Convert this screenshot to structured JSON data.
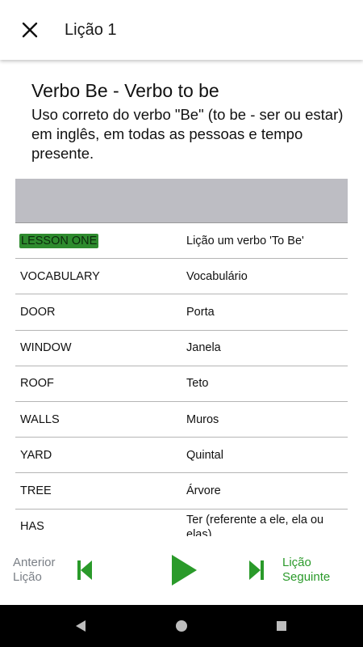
{
  "appbar": {
    "title": "Lição 1"
  },
  "lesson": {
    "title": "Verbo Be - Verbo to be",
    "subtitle": "Uso correto do verbo \"Be\" (to be - ser ou estar) em inglês, em todas as pessoas e tempo presente."
  },
  "vocab_rows": [
    {
      "en": "LESSON ONE",
      "pt": "Lição um verbo 'To Be'"
    },
    {
      "en": "VOCABULARY",
      "pt": "Vocabulário"
    },
    {
      "en": "DOOR",
      "pt": "Porta"
    },
    {
      "en": "WINDOW",
      "pt": "Janela"
    },
    {
      "en": "ROOF",
      "pt": "Teto"
    },
    {
      "en": "WALLS",
      "pt": "Muros"
    },
    {
      "en": "YARD",
      "pt": "Quintal"
    },
    {
      "en": "TREE",
      "pt": "Árvore"
    },
    {
      "en": "HAS",
      "pt": "Ter (referente a ele, ela ou elas)"
    }
  ],
  "bottom_nav": {
    "prev_label_line1": "Anterior",
    "prev_label_line2": "Lição",
    "next_label_line1": "Lição",
    "next_label_line2": "Seguinte"
  },
  "colors": {
    "accent_green": "#2a9a2a",
    "highlight_green": "#2e8b2e",
    "table_header": "#bdbdc3",
    "muted_text": "#7a7f86"
  },
  "icons": {
    "close": "close-icon",
    "prev": "skip-previous-icon",
    "play": "play-icon",
    "next": "skip-next-icon",
    "sys_back": "back-triangle-icon",
    "sys_home": "home-circle-icon",
    "sys_recents": "recents-square-icon"
  }
}
